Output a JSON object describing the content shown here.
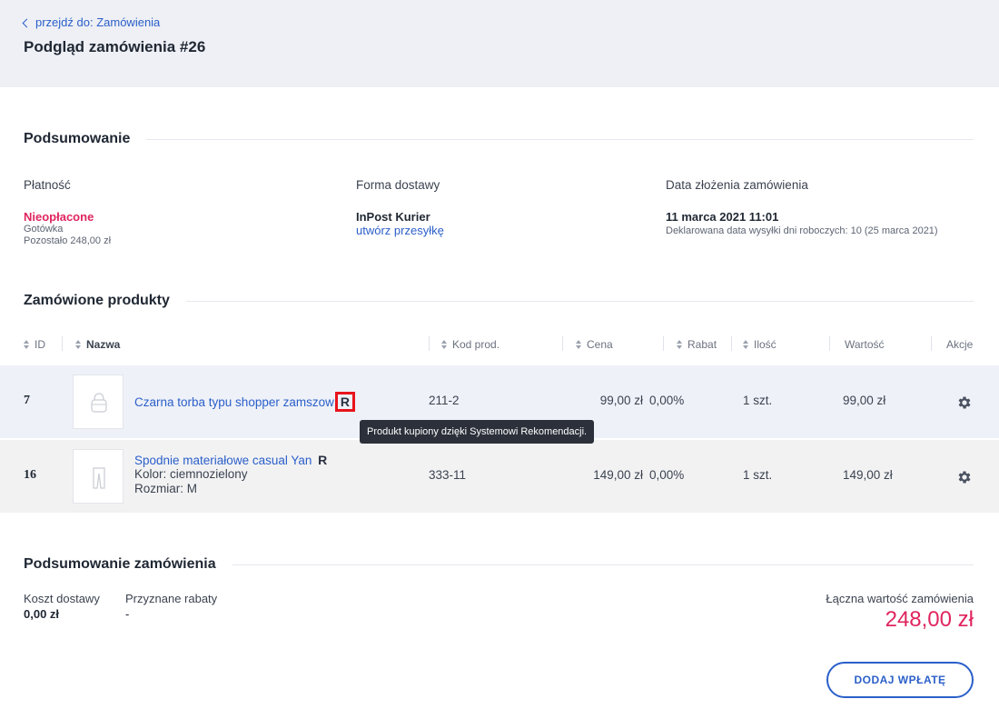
{
  "header": {
    "back_link": "przejdź do: Zamówienia",
    "title": "Podgląd zamówienia #26"
  },
  "summary": {
    "title": "Podsumowanie",
    "payment": {
      "label": "Płatność",
      "status": "Nieopłacone",
      "method": "Gotówka",
      "remaining": "Pozostało 248,00 zł",
      "status_color": "#e0245e"
    },
    "delivery": {
      "label": "Forma dostawy",
      "carrier": "InPost Kurier",
      "create_link": "utwórz przesyłkę"
    },
    "order_date": {
      "label": "Data złożenia zamówienia",
      "date": "11 marca 2021 11:01",
      "declared": "Deklarowana data wysyłki dni roboczych: 10 (25 marca 2021)"
    }
  },
  "products": {
    "title": "Zamówione produkty",
    "columns": {
      "id": "ID",
      "name": "Nazwa",
      "code": "Kod prod.",
      "price": "Cena",
      "discount": "Rabat",
      "qty": "Ilość",
      "value": "Wartość",
      "actions": "Akcje"
    },
    "rows": [
      {
        "id": "7",
        "name": "Czarna torba typu shopper zamszow",
        "badge": "R",
        "code": "211-2",
        "price": "99,00 zł",
        "discount": "0,00%",
        "qty": "1 szt.",
        "value": "99,00 zł",
        "thumb_icon": "bag-icon",
        "action_icon": "gear-icon"
      },
      {
        "id": "16",
        "name": "Spodnie materiałowe casual Yan",
        "badge": "R",
        "variant_color": "Kolor: ciemnozielony",
        "variant_size": "Rozmiar: M",
        "code": "333-11",
        "price": "149,00 zł",
        "discount": "0,00%",
        "qty": "1 szt.",
        "value": "149,00 zł",
        "thumb_icon": "trousers-icon",
        "action_icon": "gear-icon"
      }
    ],
    "tooltip": "Produkt kupiony dzięki Systemowi Rekomendacji."
  },
  "order_summary": {
    "title": "Podsumowanie zamówienia",
    "shipping_label": "Koszt dostawy",
    "shipping_value": "0,00 zł",
    "discounts_label": "Przyznane rabaty",
    "discounts_value": "-",
    "total_label": "Łączna wartość zamówienia",
    "total_value": "248,00 zł",
    "add_payment_button": "DODAJ WPŁATĘ",
    "accent_color": "#2b5fc9"
  }
}
